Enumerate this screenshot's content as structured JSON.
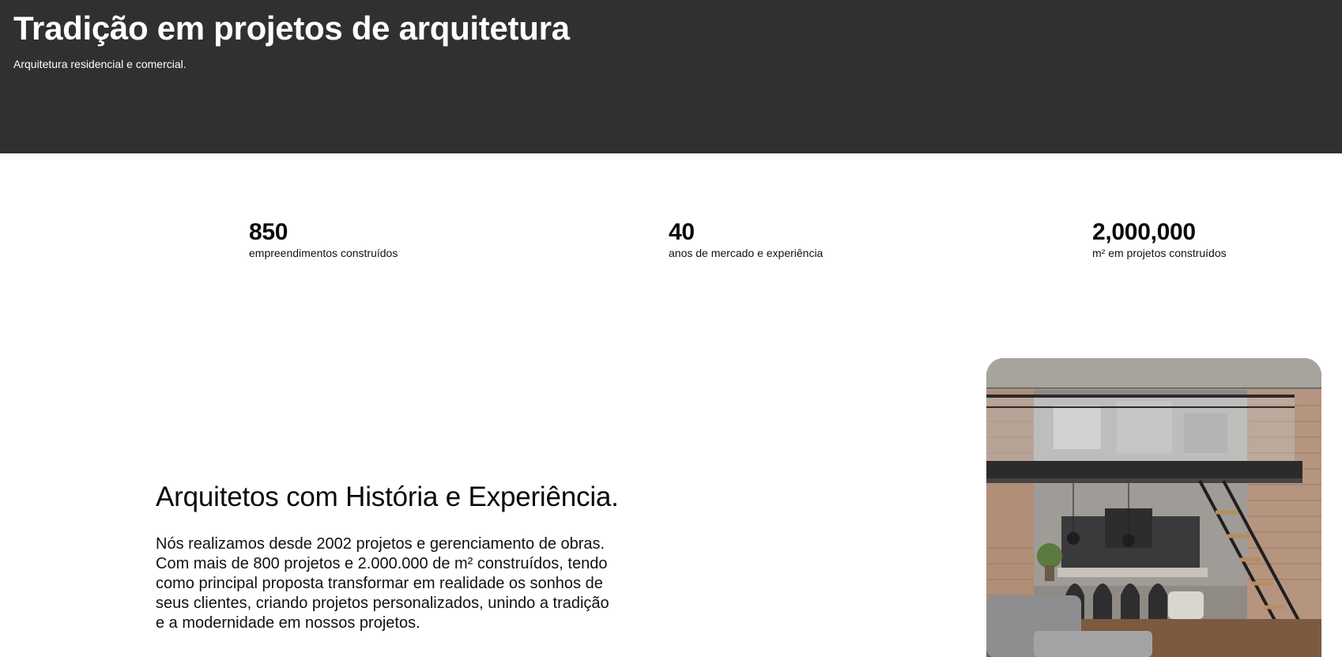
{
  "hero": {
    "title": "Tradição em projetos de arquitetura",
    "subtitle": "Arquitetura residencial e comercial.",
    "background_color": "#303030"
  },
  "stats": [
    {
      "value": "850",
      "label": "empreendimentos construídos"
    },
    {
      "value": "40",
      "label": "anos de mercado e experiência"
    },
    {
      "value": "2,000,000",
      "label": "m² em projetos construídos"
    }
  ],
  "about": {
    "heading": "Arquitetos com História e Experiência.",
    "paragraph": "Nós realizamos desde 2002 projetos e gerenciamento de obras.\nCom mais de 800 projetos e 2.000.000 de m² construídos, tendo\ncomo principal proposta transformar em realidade os sonhos de\nseus clientes, criando projetos personalizados, unindo a tradição\ne a modernidade em nossos projetos."
  },
  "photo": {
    "icon": "loft-interior-photo"
  }
}
